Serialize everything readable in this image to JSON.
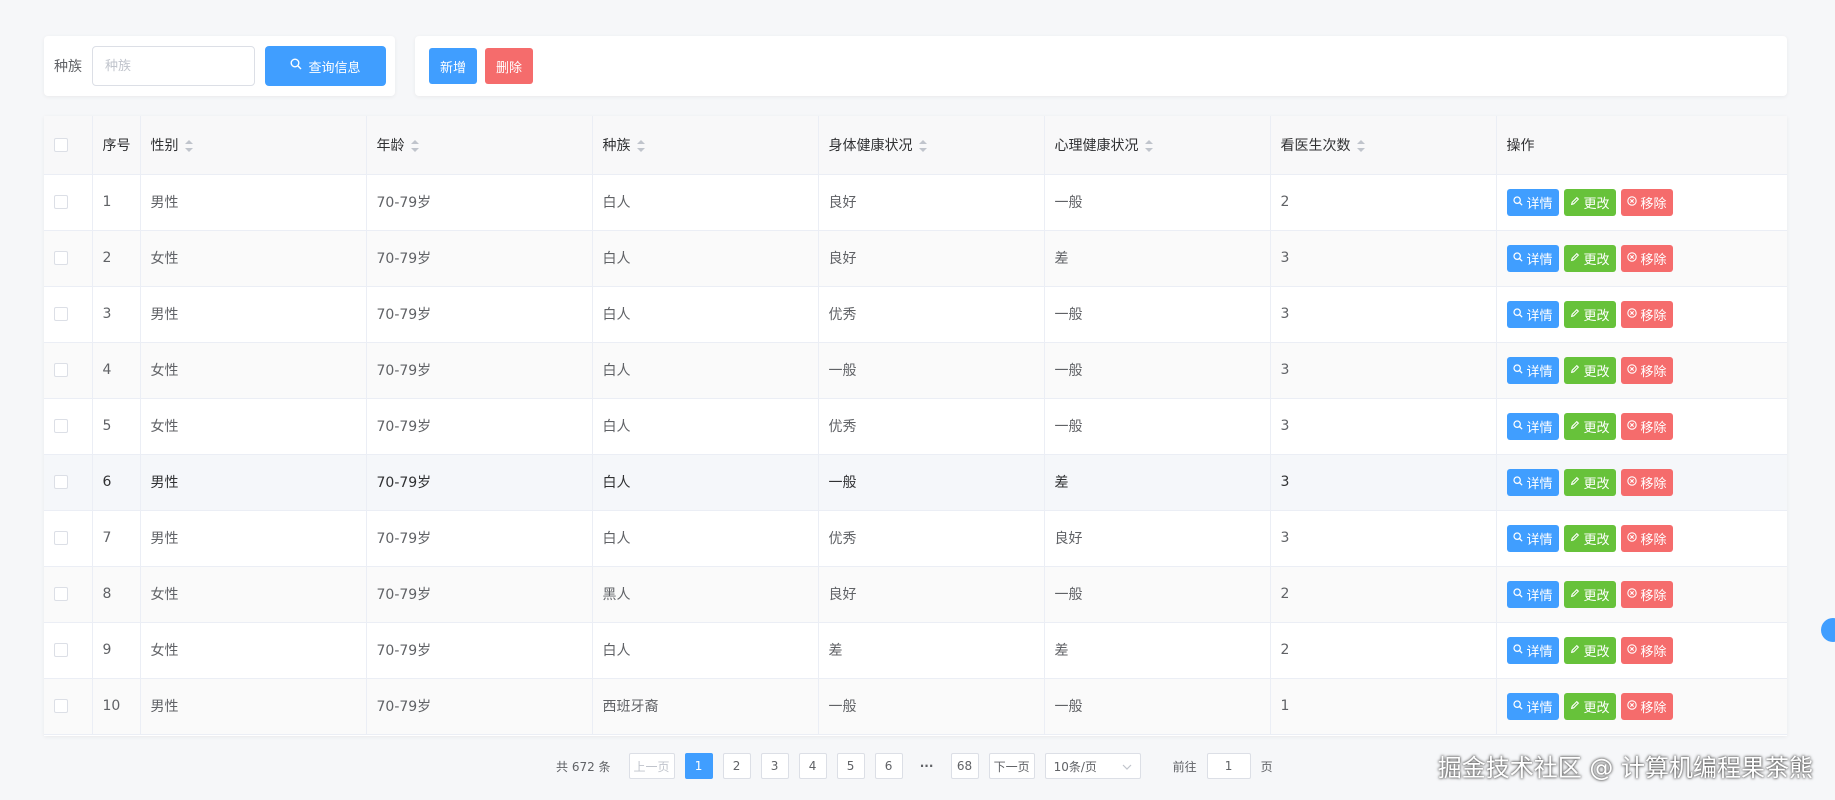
{
  "search": {
    "label": "种族",
    "placeholder": "种族",
    "query_button": "查询信息"
  },
  "toolbar": {
    "add_label": "新增",
    "delete_label": "删除"
  },
  "table": {
    "headers": {
      "index": "序号",
      "gender": "性别",
      "age": "年龄",
      "race": "种族",
      "physical": "身体健康状况",
      "mental": "心理健康状况",
      "visits": "看医生次数",
      "ops": "操作"
    },
    "op_labels": {
      "detail": "详情",
      "edit": "更改",
      "remove": "移除"
    },
    "rows": [
      {
        "index": "1",
        "gender": "男性",
        "age": "70-79岁",
        "race": "白人",
        "physical": "良好",
        "mental": "一般",
        "visits": "2"
      },
      {
        "index": "2",
        "gender": "女性",
        "age": "70-79岁",
        "race": "白人",
        "physical": "良好",
        "mental": "差",
        "visits": "3"
      },
      {
        "index": "3",
        "gender": "男性",
        "age": "70-79岁",
        "race": "白人",
        "physical": "优秀",
        "mental": "一般",
        "visits": "3"
      },
      {
        "index": "4",
        "gender": "女性",
        "age": "70-79岁",
        "race": "白人",
        "physical": "一般",
        "mental": "一般",
        "visits": "3"
      },
      {
        "index": "5",
        "gender": "女性",
        "age": "70-79岁",
        "race": "白人",
        "physical": "优秀",
        "mental": "一般",
        "visits": "3"
      },
      {
        "index": "6",
        "gender": "男性",
        "age": "70-79岁",
        "race": "白人",
        "physical": "一般",
        "mental": "差",
        "visits": "3"
      },
      {
        "index": "7",
        "gender": "男性",
        "age": "70-79岁",
        "race": "白人",
        "physical": "优秀",
        "mental": "良好",
        "visits": "3"
      },
      {
        "index": "8",
        "gender": "女性",
        "age": "70-79岁",
        "race": "黑人",
        "physical": "良好",
        "mental": "一般",
        "visits": "2"
      },
      {
        "index": "9",
        "gender": "女性",
        "age": "70-79岁",
        "race": "白人",
        "physical": "差",
        "mental": "差",
        "visits": "2"
      },
      {
        "index": "10",
        "gender": "男性",
        "age": "70-79岁",
        "race": "西班牙裔",
        "physical": "一般",
        "mental": "一般",
        "visits": "1"
      }
    ]
  },
  "pagination": {
    "total": "共 672 条",
    "prev": "上一页",
    "pages": [
      "1",
      "2",
      "3",
      "4",
      "5",
      "6"
    ],
    "more": "···",
    "last": "68",
    "next": "下一页",
    "page_size": "10条/页",
    "goto_label": "前往",
    "goto_value": "1",
    "goto_suffix": "页",
    "current": "1"
  },
  "watermark": "掘金技术社区 @ 计算机编程果茶熊",
  "colors": {
    "primary": "#409eff",
    "success": "#67c23a",
    "danger": "#f56c6c"
  },
  "icons": {
    "search": "search-icon",
    "edit": "edit-icon",
    "remove": "close-circle-icon"
  }
}
